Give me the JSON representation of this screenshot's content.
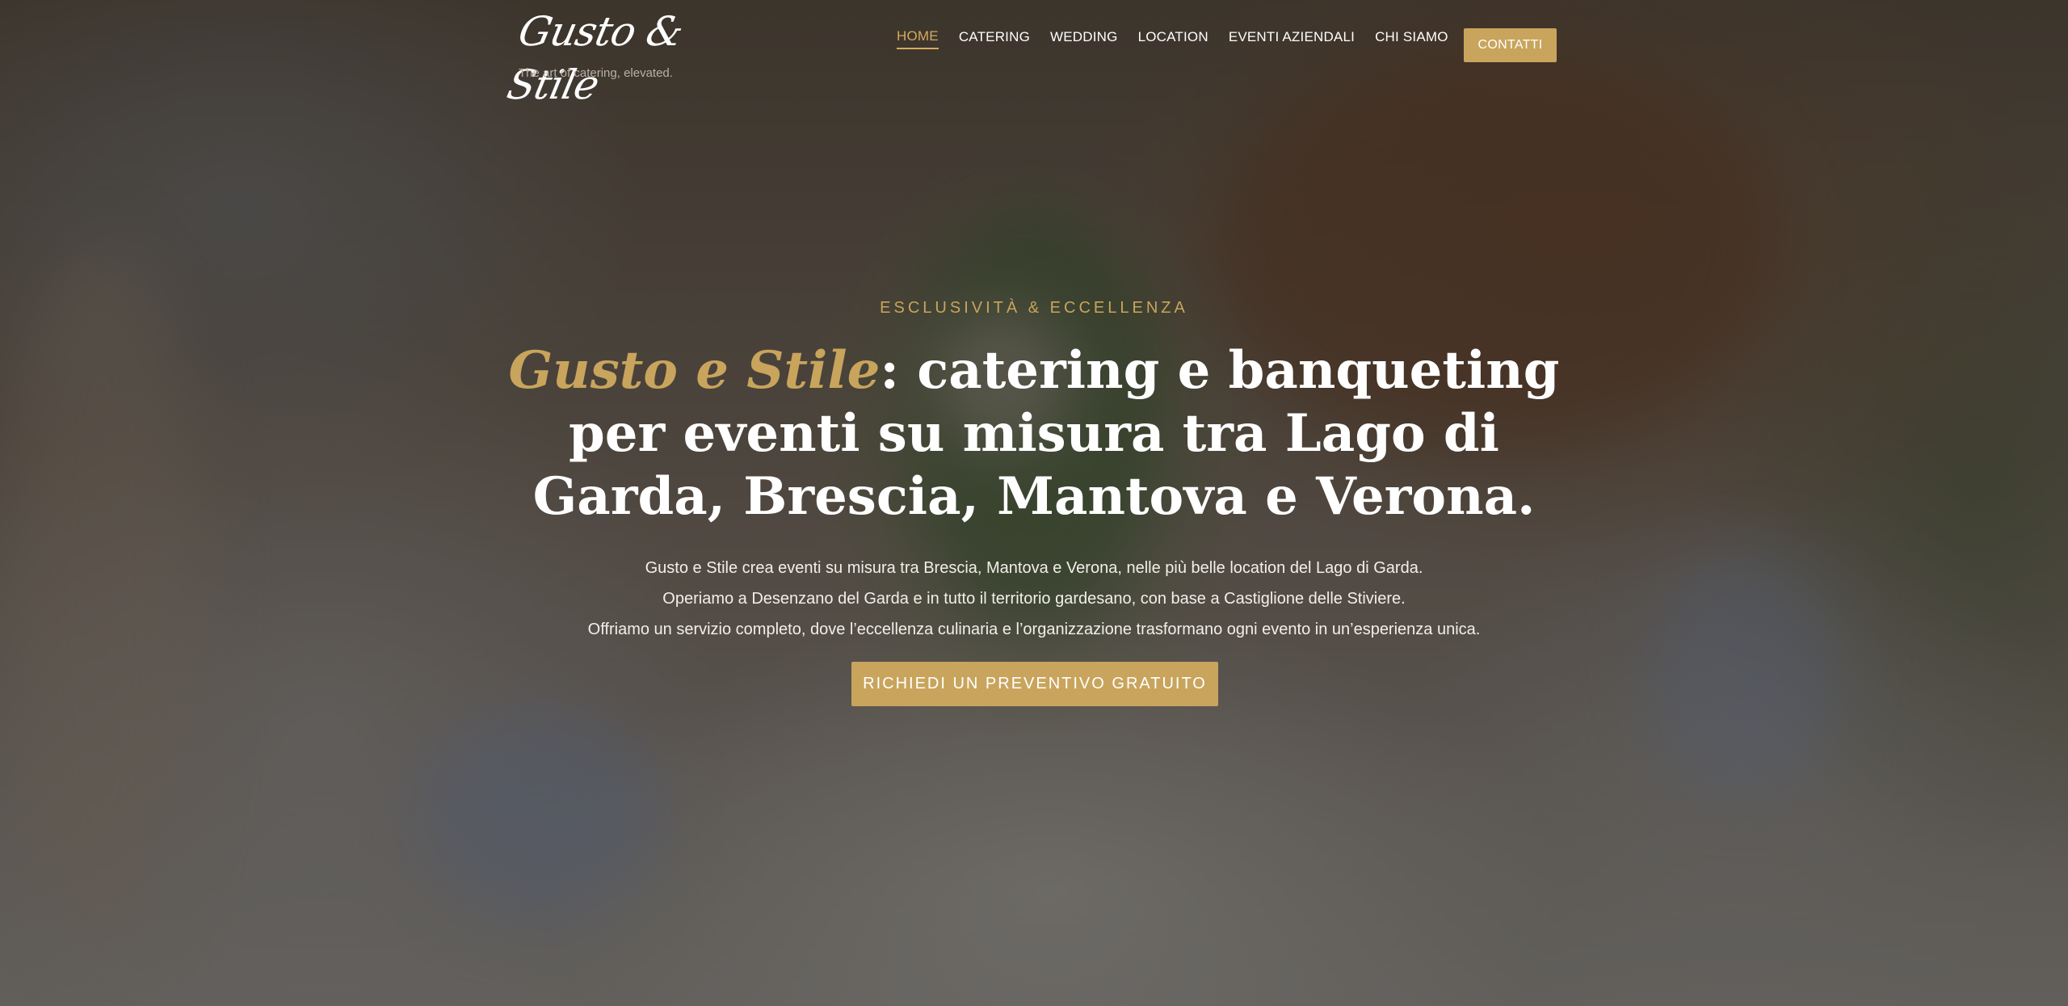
{
  "header": {
    "logo_text": "Gusto & Stile",
    "tagline": "The art of catering, elevated.",
    "nav": [
      {
        "label": "HOME",
        "active": true
      },
      {
        "label": "CATERING",
        "active": false
      },
      {
        "label": "WEDDING",
        "active": false
      },
      {
        "label": "LOCATION",
        "active": false
      },
      {
        "label": "EVENTI AZIENDALI",
        "active": false
      },
      {
        "label": "CHI SIAMO",
        "active": false
      }
    ],
    "cta_label": "CONTATTI"
  },
  "hero": {
    "eyebrow": "ESCLUSIVITÀ & ECCELLENZA",
    "headline_brand": "Gusto e Stile",
    "headline_rest": ": catering e banqueting per eventi su misura tra Lago di Garda, Brescia, Mantova e Verona.",
    "description_lines": [
      "Gusto e Stile crea eventi su misura tra Brescia, Mantova e Verona, nelle più belle location del Lago di Garda.",
      "Operiamo a Desenzano del Garda e in tutto il territorio gardesano, con base a Castiglione delle Stiviere.",
      "Offriamo un servizio completo, dove l’eccellenza culinaria e l’organizzazione trasformano ogni evento in un’esperienza unica."
    ],
    "cta_label": "RICHIEDI UN PREVENTIVO GRATUITO"
  },
  "colors": {
    "accent": "#c9a45c",
    "text": "#ffffff",
    "overlay": "#14120f"
  }
}
